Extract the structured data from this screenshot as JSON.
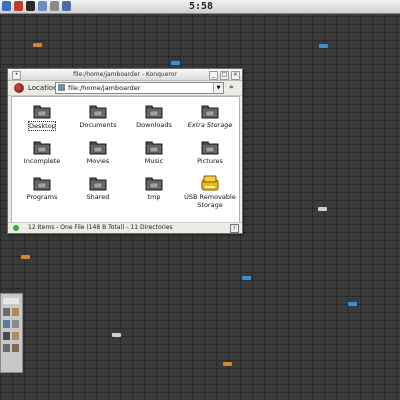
{
  "panel": {
    "clock": "5:58",
    "launchers": [
      "konqueror-icon",
      "kde-menu-icon",
      "terminal-icon",
      "home-icon",
      "settings-icon",
      "browser-icon"
    ]
  },
  "window": {
    "title": "file:/home/jamboarder - Konqueror",
    "location_label": "Location:",
    "location_value": "file:/home/jamboarder",
    "items": [
      {
        "label": "Desktop",
        "icon": "desktop-folder-icon",
        "style": "boxed"
      },
      {
        "label": "Documents",
        "icon": "documents-folder-icon",
        "style": ""
      },
      {
        "label": "Downloads",
        "icon": "downloads-folder-icon",
        "style": ""
      },
      {
        "label": "Extra Storage",
        "icon": "storage-folder-icon",
        "style": "italic"
      },
      {
        "label": "Incomplete",
        "icon": "incomplete-folder-icon",
        "style": ""
      },
      {
        "label": "Movies",
        "icon": "movies-folder-icon",
        "style": ""
      },
      {
        "label": "Music",
        "icon": "music-folder-icon",
        "style": ""
      },
      {
        "label": "Pictures",
        "icon": "pictures-folder-icon",
        "style": ""
      },
      {
        "label": "Programs",
        "icon": "programs-folder-icon",
        "style": ""
      },
      {
        "label": "Shared",
        "icon": "shared-folder-icon",
        "style": ""
      },
      {
        "label": "tmp",
        "icon": "tmp-folder-icon",
        "style": ""
      },
      {
        "label": "USB Removable Storage",
        "icon": "usb-drive-icon",
        "style": ""
      }
    ],
    "status": "12 Items - One File (148 B Total) - 11 Directories"
  },
  "colors": {
    "desktop_bg": "#3a3a3a",
    "tile_orange": "#d8842a",
    "tile_blue": "#3a90d0",
    "tile_white": "#d0d0d0",
    "folder_dark": "#4a4a4a"
  }
}
